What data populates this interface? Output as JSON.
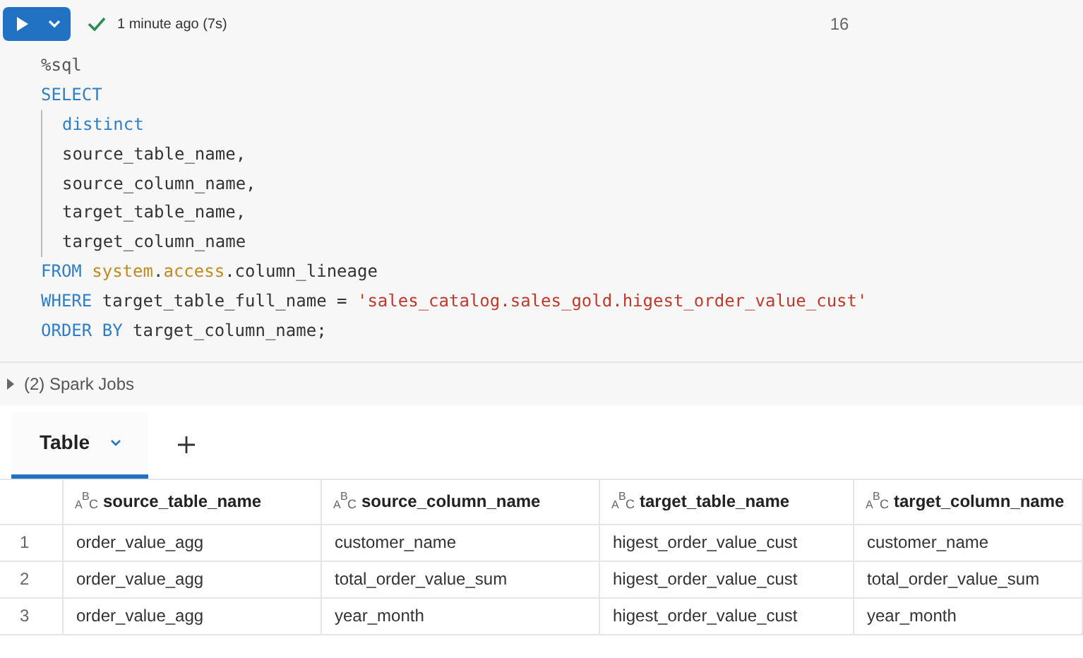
{
  "toolbar": {
    "succeeded": true,
    "status": "1 minute ago (7s)",
    "line_count": "16"
  },
  "code": {
    "lines": [
      {
        "tokens": [
          {
            "kind": "magic",
            "text": "%sql"
          }
        ]
      },
      {
        "tokens": [
          {
            "kind": "keyword",
            "text": "SELECT"
          }
        ],
        "children": [
          {
            "tokens": [
              {
                "kind": "keyword",
                "text": "distinct"
              }
            ]
          },
          {
            "tokens": [
              {
                "kind": "plain",
                "text": "source_table_name,"
              }
            ]
          },
          {
            "tokens": [
              {
                "kind": "plain",
                "text": "source_column_name,"
              }
            ]
          },
          {
            "tokens": [
              {
                "kind": "plain",
                "text": "target_table_name,"
              }
            ]
          },
          {
            "tokens": [
              {
                "kind": "plain",
                "text": "target_column_name"
              }
            ]
          }
        ]
      },
      {
        "tokens": [
          {
            "kind": "keyword",
            "text": "FROM "
          },
          {
            "kind": "schema",
            "text": "system"
          },
          {
            "kind": "plain",
            "text": "."
          },
          {
            "kind": "schema",
            "text": "access"
          },
          {
            "kind": "plain",
            "text": ".column_lineage"
          }
        ]
      },
      {
        "tokens": [
          {
            "kind": "keyword",
            "text": "WHERE "
          },
          {
            "kind": "plain",
            "text": "target_table_full_name = "
          },
          {
            "kind": "string",
            "text": "'sales_catalog.sales_gold.higest_order_value_cust'"
          }
        ]
      },
      {
        "tokens": [
          {
            "kind": "keyword",
            "text": "ORDER BY "
          },
          {
            "kind": "plain",
            "text": "target_column_name;"
          }
        ]
      }
    ]
  },
  "spark_jobs": {
    "label": "(2) Spark Jobs",
    "expanded": false
  },
  "tabs": [
    {
      "label": "Table",
      "selected": true
    }
  ],
  "table": {
    "columns": [
      {
        "type_glyph": "ABC",
        "name": "source_table_name"
      },
      {
        "type_glyph": "ABC",
        "name": "source_column_name"
      },
      {
        "type_glyph": "ABC",
        "name": "target_table_name"
      },
      {
        "type_glyph": "ABC",
        "name": "target_column_name"
      }
    ],
    "rows": [
      {
        "index": "1",
        "cells": [
          "order_value_agg",
          "customer_name",
          "higest_order_value_cust",
          "customer_name"
        ]
      },
      {
        "index": "2",
        "cells": [
          "order_value_agg",
          "total_order_value_sum",
          "higest_order_value_cust",
          "total_order_value_sum"
        ]
      },
      {
        "index": "3",
        "cells": [
          "order_value_agg",
          "year_month",
          "higest_order_value_cust",
          "year_month"
        ]
      }
    ]
  }
}
